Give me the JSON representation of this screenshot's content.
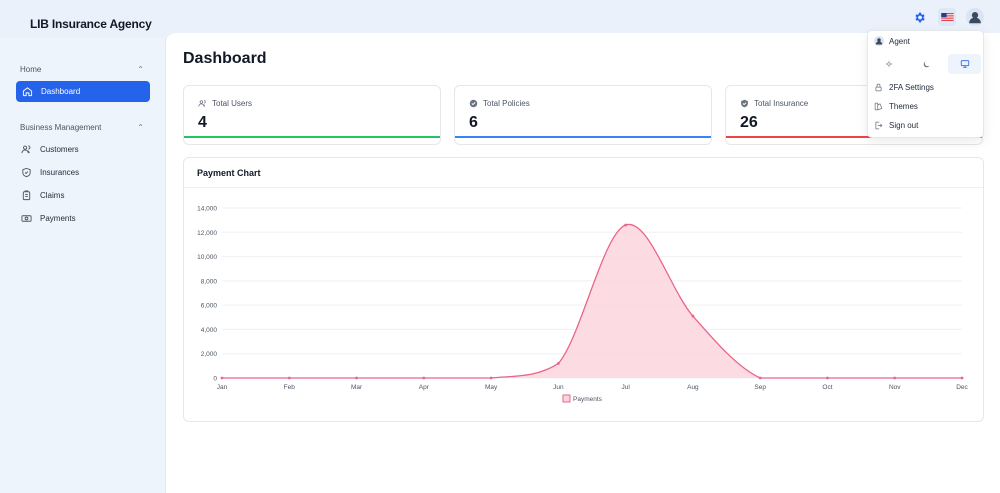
{
  "app": {
    "brand": "LIB Insurance Agency"
  },
  "topbar": {
    "settings_icon": "gear-icon",
    "language_icon": "us-flag-icon",
    "profile_icon": "user-avatar-icon"
  },
  "sidebar": {
    "sections": [
      {
        "label": "Home",
        "items": [
          {
            "label": "Dashboard",
            "icon": "home-icon",
            "active": true
          }
        ]
      },
      {
        "label": "Business Management",
        "items": [
          {
            "label": "Customers",
            "icon": "users-icon"
          },
          {
            "label": "Insurances",
            "icon": "shield-icon"
          },
          {
            "label": "Claims",
            "icon": "clipboard-icon"
          },
          {
            "label": "Payments",
            "icon": "banknote-icon"
          }
        ]
      }
    ]
  },
  "main": {
    "title": "Dashboard",
    "stats": [
      {
        "label": "Total Users",
        "value": "4",
        "icon": "users-icon",
        "color": "#22c55e"
      },
      {
        "label": "Total Policies",
        "value": "6",
        "icon": "check-badge-icon",
        "color": "#3b82f6"
      },
      {
        "label": "Total Insurance",
        "value": "26",
        "icon": "shield-check-icon",
        "color": "#ef4444"
      }
    ],
    "chart_title": "Payment Chart"
  },
  "chart_data": {
    "type": "area",
    "title": "Payment Chart",
    "categories": [
      "Jan",
      "Feb",
      "Mar",
      "Apr",
      "May",
      "Jun",
      "Jul",
      "Aug",
      "Sep",
      "Oct",
      "Nov",
      "Dec"
    ],
    "series": [
      {
        "name": "Payments",
        "values": [
          0,
          0,
          0,
          0,
          0,
          1200,
          12600,
          5100,
          0,
          0,
          0,
          0
        ]
      }
    ],
    "ylim": [
      0,
      14000
    ],
    "yticks": [
      "0",
      "2,000",
      "4,000",
      "6,000",
      "8,000",
      "10,000",
      "12,000",
      "14,000"
    ],
    "grid": true,
    "legend": "bottom-center",
    "color": "#e8668a",
    "fill": "#fbd5de"
  },
  "dropdown": {
    "user_label": "Agent",
    "modes": [
      {
        "icon": "sun-icon"
      },
      {
        "icon": "moon-icon"
      },
      {
        "icon": "monitor-icon",
        "active": true
      }
    ],
    "items": [
      {
        "label": "2FA Settings",
        "icon": "lock-icon"
      },
      {
        "label": "Themes",
        "icon": "palette-icon"
      },
      {
        "label": "Sign out",
        "icon": "sign-out-icon"
      }
    ]
  }
}
